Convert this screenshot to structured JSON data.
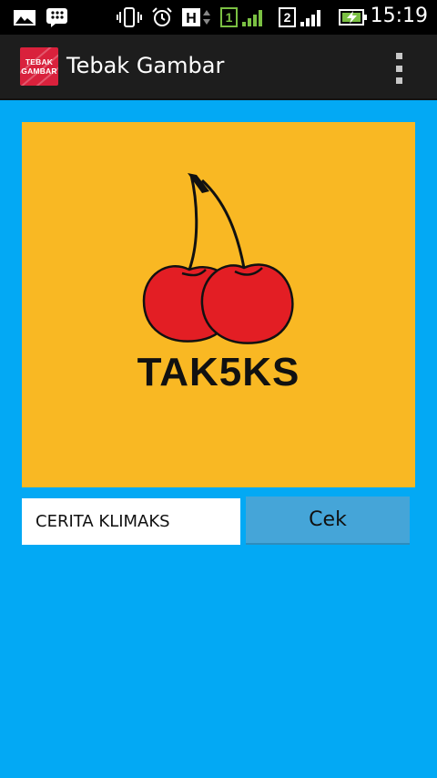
{
  "status_bar": {
    "time": "15:19",
    "icons": [
      "gallery-icon",
      "bbm-icon",
      "vibrate-icon",
      "alarm-icon",
      "hspa-icon",
      "sim1-signal-icon",
      "sim2-signal-icon",
      "battery-charging-icon"
    ],
    "sim1_label": "1",
    "sim2_label": "2",
    "network_label": "H"
  },
  "action_bar": {
    "logo_line1": "TEBAK",
    "logo_line2": "GAMBAR",
    "title": "Tebak Gambar",
    "overflow_icon": "overflow-menu-icon"
  },
  "puzzle": {
    "image_subject": "cherry",
    "clue_text": "TAK5KS",
    "background_color": "#f9b823"
  },
  "answer": {
    "value": "CERITA KLIMAKS"
  },
  "check_button": {
    "label": "Cek"
  },
  "colors": {
    "background": "#03a9f4",
    "button": "#45a5d8",
    "cherry_red": "#e31e24"
  }
}
